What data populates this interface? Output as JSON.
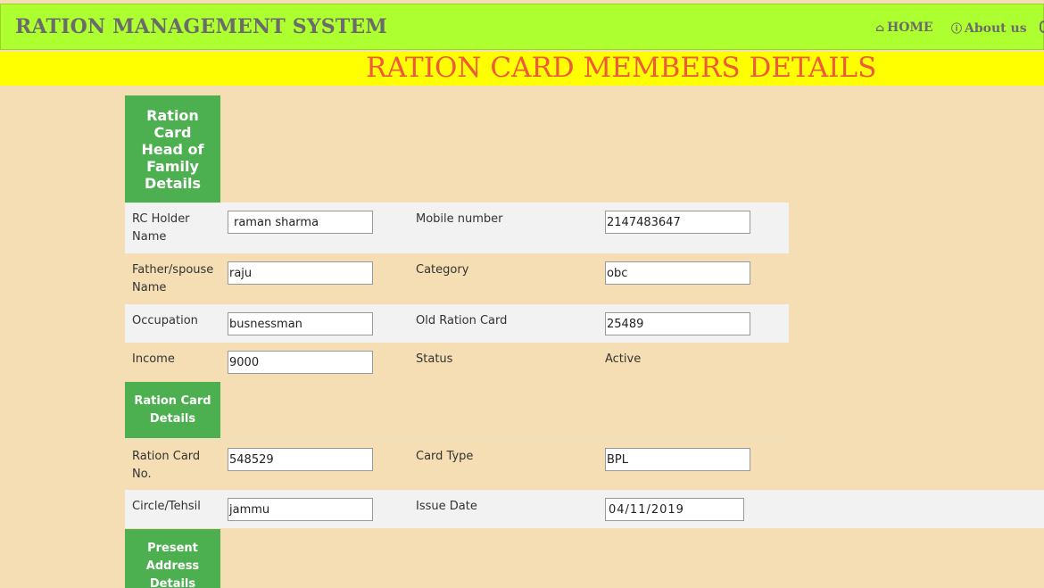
{
  "header": {
    "brand": "RATION MANAGEMENT SYSTEM",
    "nav": [
      {
        "label": "HOME",
        "icon": "home-icon"
      },
      {
        "label": "About us",
        "icon": "info-icon"
      }
    ]
  },
  "page_title": "RATION CARD MEMBERS DETAILS",
  "sections": {
    "head_of_family": "Ration Card Head of Family Details",
    "ration_card": "Ration Card Details",
    "present_address": "Present Address Details"
  },
  "fields": {
    "rc_holder_name": {
      "label": "RC Holder Name",
      "value": "raman sharma"
    },
    "mobile_number": {
      "label": "Mobile number",
      "value": "2147483647"
    },
    "father_spouse_name": {
      "label": "Father/spouse Name",
      "value": "raju"
    },
    "category": {
      "label": "Category",
      "value": "obc"
    },
    "occupation": {
      "label": "Occupation",
      "value": "busnessman"
    },
    "old_ration_card": {
      "label": "Old Ration Card",
      "value": "25489"
    },
    "income": {
      "label": "Income",
      "value": "9000"
    },
    "status": {
      "label": "Status",
      "value": "Active"
    },
    "ration_card_no": {
      "label": "Ration Card No.",
      "value": "548529"
    },
    "card_type": {
      "label": "Card Type",
      "value": "BPL"
    },
    "circle_tehsil": {
      "label": "Circle/Tehsil",
      "value": "jammu"
    },
    "issue_date": {
      "label": "Issue Date",
      "value": "04/11/2019"
    }
  },
  "colors": {
    "navbar": "#adff2f",
    "banner": "#ffff00",
    "title_text": "#f05a3c",
    "section_header": "#4caf50",
    "page_bg": "#f5deb3"
  }
}
